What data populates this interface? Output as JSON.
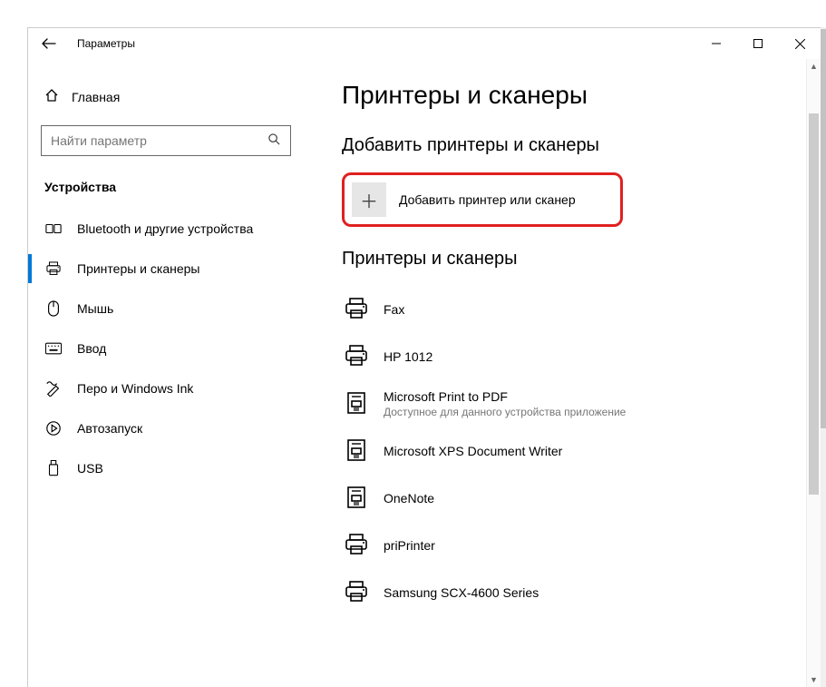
{
  "window": {
    "title": "Параметры"
  },
  "sidebar": {
    "home_label": "Главная",
    "search_placeholder": "Найти параметр",
    "section": "Устройства",
    "items": [
      {
        "label": "Bluetooth и другие устройства"
      },
      {
        "label": "Принтеры и сканеры"
      },
      {
        "label": "Мышь"
      },
      {
        "label": "Ввод"
      },
      {
        "label": "Перо и Windows Ink"
      },
      {
        "label": "Автозапуск"
      },
      {
        "label": "USB"
      }
    ]
  },
  "main": {
    "heading": "Принтеры и сканеры",
    "add_section_heading": "Добавить принтеры и сканеры",
    "add_button_label": "Добавить принтер или сканер",
    "list_heading": "Принтеры и сканеры",
    "printers": [
      {
        "name": "Fax",
        "type": "printer"
      },
      {
        "name": "HP 1012",
        "type": "printer"
      },
      {
        "name": "Microsoft Print to PDF",
        "type": "app",
        "sub": "Доступное для данного устройства приложение"
      },
      {
        "name": "Microsoft XPS Document Writer",
        "type": "app"
      },
      {
        "name": "OneNote",
        "type": "app"
      },
      {
        "name": "priPrinter",
        "type": "printer"
      },
      {
        "name": "Samsung SCX-4600 Series",
        "type": "printer"
      }
    ]
  }
}
